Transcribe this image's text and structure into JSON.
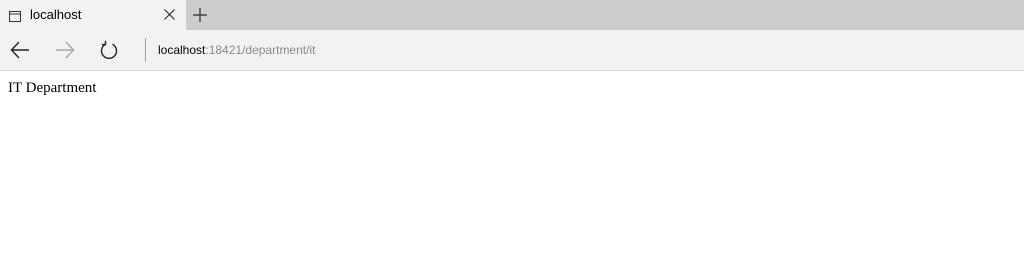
{
  "tab": {
    "title": "localhost",
    "icon": "page-icon",
    "close_icon": "close-icon"
  },
  "new_tab_icon": "plus-icon",
  "toolbar": {
    "back_icon": "arrow-left-icon",
    "forward_icon": "arrow-right-icon",
    "refresh_icon": "refresh-icon"
  },
  "address": {
    "host": "localhost",
    "rest": ":18421/department/it"
  },
  "page": {
    "text": "IT Department"
  },
  "colors": {
    "tab_strip": "#cccccc",
    "toolbar": "#f2f2f2",
    "url_muted": "#8a8a8a"
  }
}
